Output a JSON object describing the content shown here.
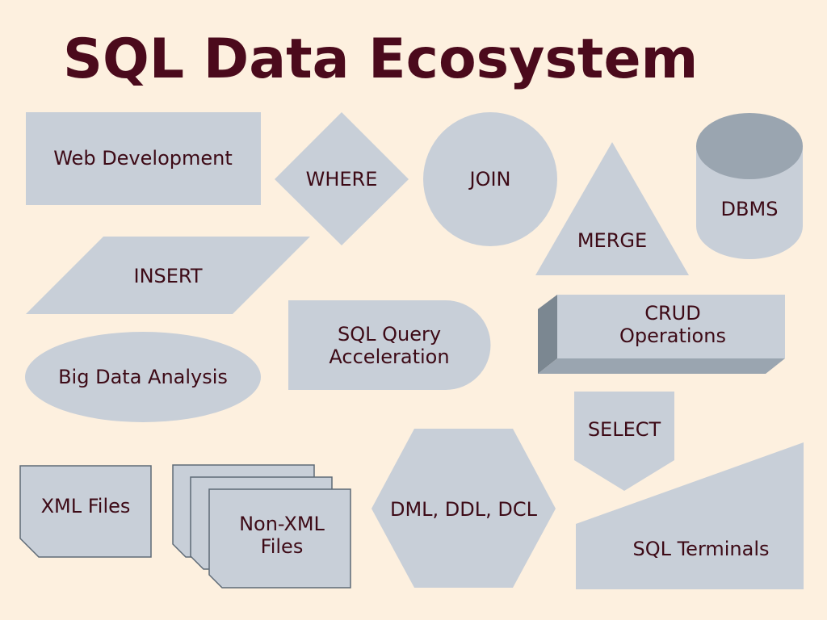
{
  "title": "SQL Data Ecosystem",
  "colors": {
    "background": "#fdf0df",
    "title": "#4b0a1c",
    "shape_fill": "#c8cfd8",
    "shape_dark": "#9aa5b0",
    "shape_side": "#7b8791",
    "label_text": "#3d0a16"
  },
  "shapes": {
    "web_development": {
      "shape": "rectangle",
      "label": "Web Development"
    },
    "where": {
      "shape": "diamond",
      "label": "WHERE"
    },
    "join": {
      "shape": "circle",
      "label": "JOIN"
    },
    "merge": {
      "shape": "triangle",
      "label": "MERGE"
    },
    "dbms": {
      "shape": "cylinder",
      "label": "DBMS"
    },
    "insert": {
      "shape": "parallelogram",
      "label": "INSERT"
    },
    "sql_query_acceleration": {
      "shape": "delay",
      "label_lines": [
        "SQL Query",
        "Acceleration"
      ]
    },
    "crud_operations": {
      "shape": "3d-box",
      "label_lines": [
        "CRUD",
        "Operations"
      ]
    },
    "big_data_analysis": {
      "shape": "ellipse",
      "label": "Big Data Analysis"
    },
    "select": {
      "shape": "pentagon-arrow",
      "label": "SELECT"
    },
    "xml_files": {
      "shape": "card",
      "label": "XML Files"
    },
    "non_xml_files": {
      "shape": "stacked-cards",
      "label_lines": [
        "Non-XML",
        "Files"
      ]
    },
    "dml_ddl_dcl": {
      "shape": "hexagon",
      "label": "DML, DDL, DCL"
    },
    "sql_terminals": {
      "shape": "manual-input",
      "label": "SQL Terminals"
    }
  }
}
